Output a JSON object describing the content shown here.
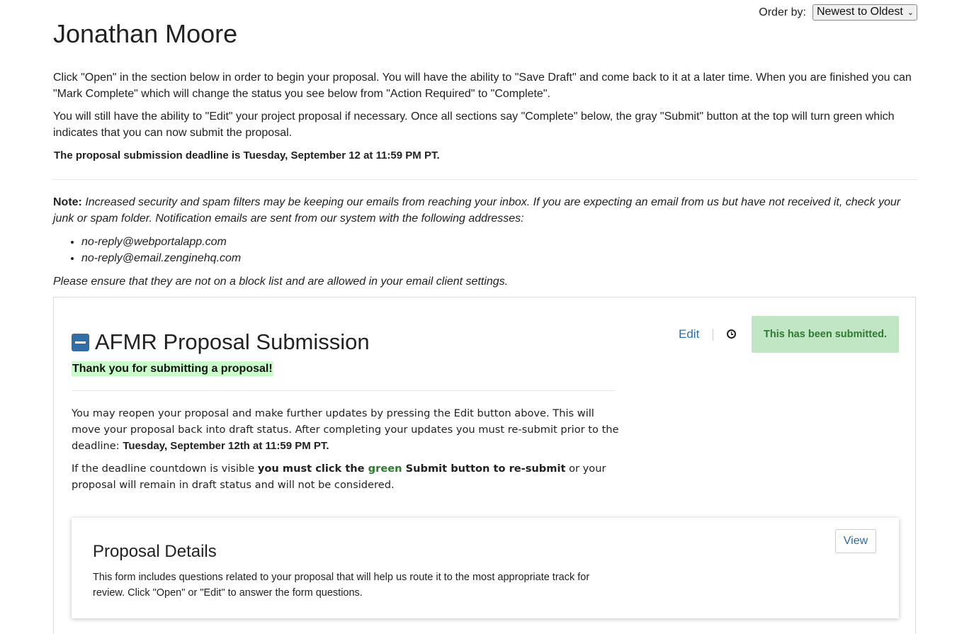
{
  "header": {
    "order_label": "Order by:",
    "order_value": "Newest to Oldest",
    "title": "Jonathan Moore"
  },
  "intro": {
    "p1": "Click \"Open\" in the section below in order to begin your proposal. You will have the ability to \"Save Draft\"  and come back to it at a later time. When you are finished you can \"Mark Complete\" which will change the status you see below from \"Action Required\" to \"Complete\".",
    "p2": "You will still have the ability to \"Edit\" your project proposal if necessary. Once all sections say \"Complete\" below, the gray \"Submit\" button at the top will turn green which indicates that you can now submit the proposal.",
    "deadline": "The proposal submission deadline is Tuesday, September 12 at 11:59 PM PT."
  },
  "note": {
    "label": "Note:",
    "text": " Increased security and spam filters may be keeping our emails from reaching your inbox. If you are expecting an email from us but have not received it, check your junk or spam folder. Notification emails are sent from our system with the following addresses:",
    "emails": [
      "no-reply@webportalapp.com",
      "no-reply@email.zenginehq.com"
    ],
    "ensure": "Please ensure that they are not on a block list and are allowed in your email client settings."
  },
  "section": {
    "title": "AFMR Proposal Submission",
    "thanks": "Thank you for submitting a proposal!",
    "edit_label": "Edit",
    "status_badge": "This has been submitted.",
    "reopen_p1_a": "You may reopen your proposal and make further updates by pressing the Edit button above.  This will move your proposal back into draft status.  After completing your updates you must re-submit prior to the deadline: ",
    "reopen_p1_deadline": "Tuesday, September 12th at 11:59 PM PT.",
    "reopen_p2_a": "If the deadline countdown is visible ",
    "reopen_p2_bold1": "you must click the ",
    "reopen_p2_green": "green",
    "reopen_p2_bold2": " Submit button to re-submit",
    "reopen_p2_b": " or your proposal will remain in draft status and will not be considered."
  },
  "details": {
    "title": "Proposal Details",
    "description": "This form includes questions related to your proposal that will help us route it to the most appropriate track for review. Click \"Open\" or \"Edit\" to answer the form questions.",
    "view_label": "View"
  },
  "colors": {
    "accent": "#2f6ea8",
    "success_bg": "#c1e6c3",
    "success_text": "#2f7a32",
    "highlight": "#c8fcc8"
  }
}
